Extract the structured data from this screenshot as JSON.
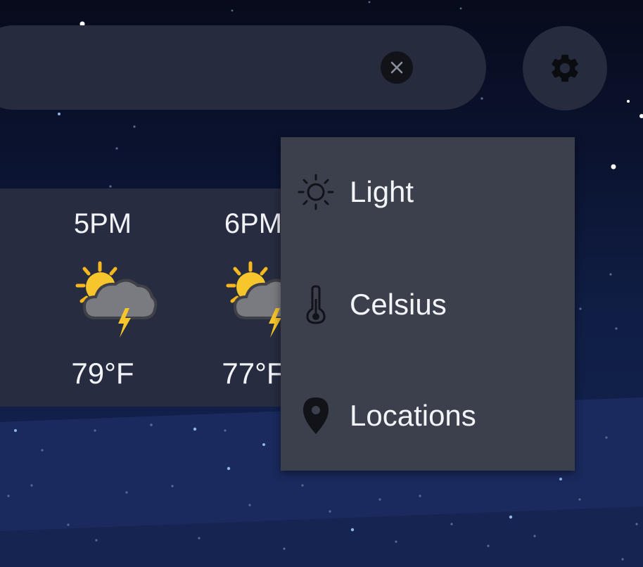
{
  "search": {
    "clear_icon": "close-icon"
  },
  "settings": {
    "icon": "gear-icon"
  },
  "hourly": [
    {
      "time": "5PM",
      "icon": "sun-cloud-lightning-icon",
      "temp": "79°F"
    },
    {
      "time": "6PM",
      "icon": "sun-cloud-lightning-icon",
      "temp": "77°F"
    }
  ],
  "menu": {
    "items": [
      {
        "label": "Light",
        "icon": "sun-icon"
      },
      {
        "label": "Celsius",
        "icon": "thermometer-icon"
      },
      {
        "label": "Locations",
        "icon": "location-pin-icon"
      }
    ]
  }
}
